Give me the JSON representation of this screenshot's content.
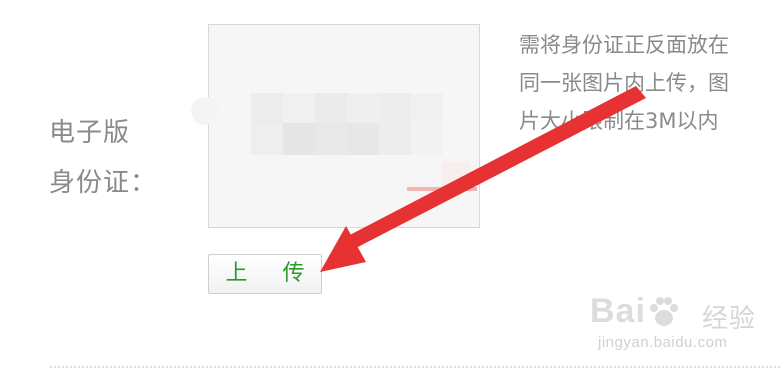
{
  "form": {
    "label_line1": "电子版",
    "label_line2": "身份证：",
    "upload_button_label": "上 传",
    "hint_lines": [
      "需将身份证正反面放在",
      "同一张图片内上传，图",
      "片大小限制在3M以内"
    ]
  },
  "watermark": {
    "brand": "Bai",
    "brand_suffix": "经验",
    "url": "jingyan.baidu.com"
  },
  "annotation": {
    "arrow_color": "#e63232"
  },
  "colors": {
    "label_text": "#8a8a8a",
    "button_text": "#2a9a2a",
    "box_bg": "#f6f6f6",
    "box_border": "#d8d8d8"
  }
}
